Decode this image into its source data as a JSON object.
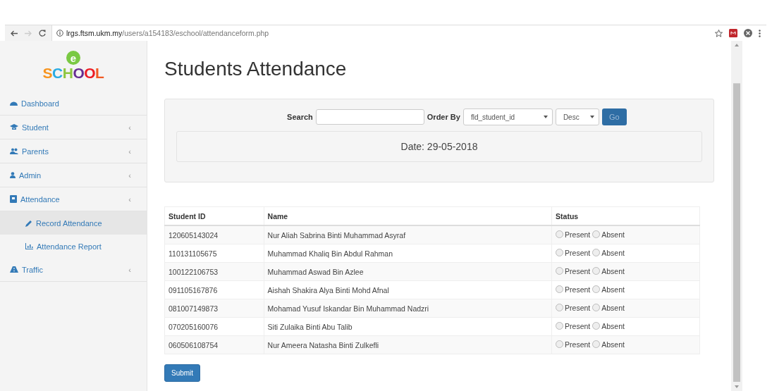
{
  "browser": {
    "url": {
      "host": "lrgs.ftsm.ukm.my",
      "path": "/users/a154183/eschool/attendanceform.php"
    }
  },
  "logo": {
    "badge": "e",
    "name": "SCHOOL"
  },
  "sidebar": {
    "items": [
      {
        "label": "Dashboard",
        "selected": false
      },
      {
        "label": "Student",
        "selected": false,
        "caret": "‹"
      },
      {
        "label": "Parents",
        "selected": false,
        "caret": "‹"
      },
      {
        "label": "Admin",
        "selected": false,
        "caret": "‹"
      },
      {
        "label": "Attendance",
        "selected": false,
        "caret": "‹",
        "children": [
          {
            "label": "Record Attendance",
            "selected": true
          },
          {
            "label": "Attendance Report",
            "selected": false
          }
        ]
      },
      {
        "label": "Traffic",
        "selected": false,
        "caret": "‹"
      }
    ]
  },
  "page": {
    "title": "Students Attendance"
  },
  "filter": {
    "search_label": "Search",
    "order_label": "Order By",
    "order_value": "fld_student_id",
    "direction_value": "Desc",
    "go_button": "Go",
    "date": "Date: 29-05-2018"
  },
  "table": {
    "columns": [
      "Student ID",
      "Name",
      "Status"
    ],
    "rows": [
      {
        "id": "120605143024",
        "name": "Nur Aliah Sabrina Binti Muhammad Asyraf",
        "options": [
          {
            "label": "Present",
            "selected": false
          },
          {
            "label": "Absent",
            "selected": false
          }
        ]
      },
      {
        "id": "110131105675",
        "name": "Muhammad Khaliq Bin Abdul Rahman",
        "options": [
          {
            "label": "Present",
            "selected": false
          },
          {
            "label": "Absent",
            "selected": false
          }
        ]
      },
      {
        "id": "100122106753",
        "name": "Muhammad Aswad Bin Azlee",
        "options": [
          {
            "label": "Present",
            "selected": false
          },
          {
            "label": "Absent",
            "selected": false
          }
        ]
      },
      {
        "id": "091105167876",
        "name": "Aishah Shakira Alya Binti Mohd Afnal",
        "options": [
          {
            "label": "Present",
            "selected": false
          },
          {
            "label": "Absent",
            "selected": false
          }
        ]
      },
      {
        "id": "081007149873",
        "name": "Mohamad Yusuf Iskandar Bin Muhammad Nadzri",
        "options": [
          {
            "label": "Present",
            "selected": false
          },
          {
            "label": "Absent",
            "selected": false
          }
        ]
      },
      {
        "id": "070205160076",
        "name": "Siti Zulaika Binti Abu Talib",
        "options": [
          {
            "label": "Present",
            "selected": false
          },
          {
            "label": "Absent",
            "selected": false
          }
        ]
      },
      {
        "id": "060506108754",
        "name": "Nur Ameera Natasha Binti Zulkefli",
        "options": [
          {
            "label": "Present",
            "selected": false
          },
          {
            "label": "Absent",
            "selected": false
          }
        ]
      }
    ]
  },
  "submit_button": "Submit"
}
